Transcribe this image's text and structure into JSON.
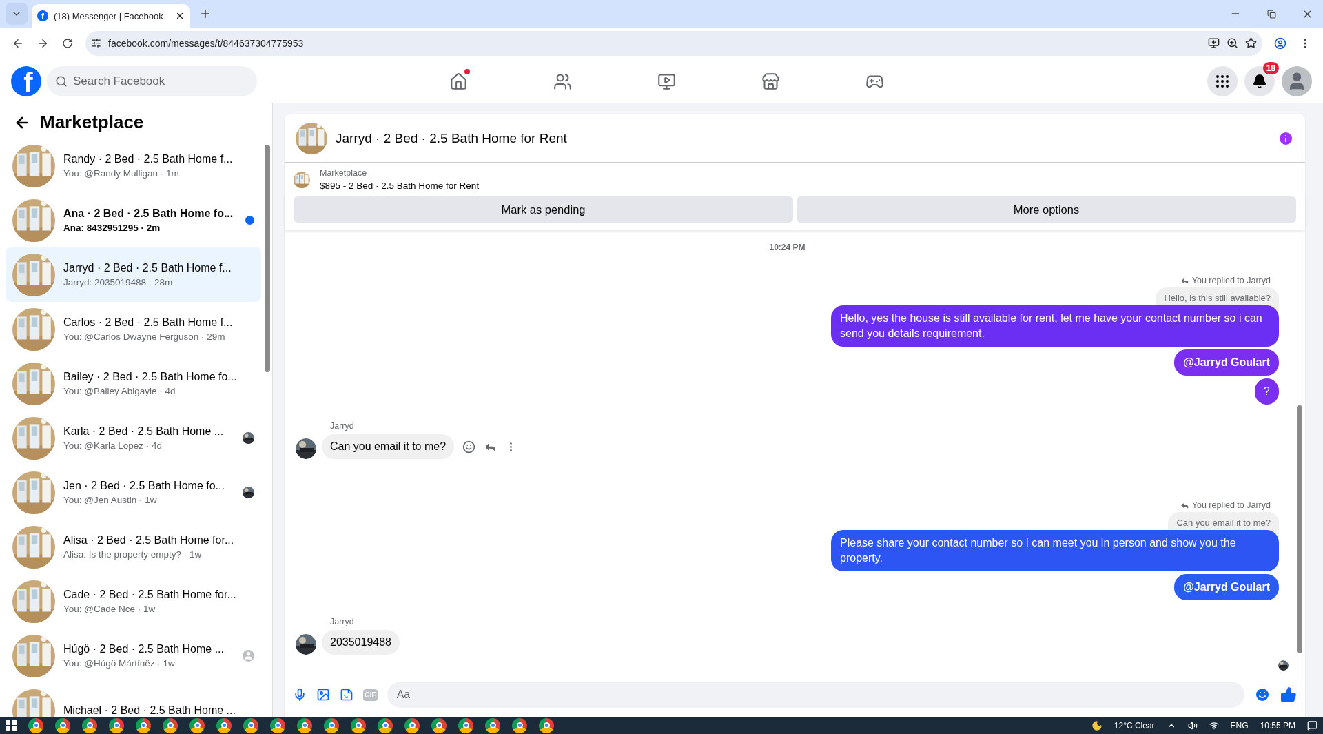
{
  "browser": {
    "favicon": "f",
    "tab_title": "(18) Messenger | Facebook",
    "url": "facebook.com/messages/t/844637304775953"
  },
  "header": {
    "logo": "f",
    "search_placeholder": "Search Facebook",
    "nav": [
      {
        "dot": true
      },
      {
        "dot": false
      },
      {
        "dot": false
      },
      {
        "dot": false
      },
      {
        "dot": false
      }
    ],
    "notification_count": "18"
  },
  "sidebar": {
    "title": "Marketplace",
    "conversations": [
      {
        "kind": "plain",
        "title": "Randy · 2 Bed · 2.5 Bath Home f...",
        "preview": "You: @Randy Mulligan · 1m",
        "unread": false,
        "selected": false
      },
      {
        "kind": "plain",
        "title": "Ana · 2 Bed · 2.5 Bath Home fo...",
        "preview": "Ana: 8432951295 · 2m",
        "unread": true,
        "selected": false
      },
      {
        "kind": "plain",
        "title": "Jarryd · 2 Bed · 2.5 Bath Home f...",
        "preview": "Jarryd: 2035019488 · 28m",
        "unread": false,
        "selected": true
      },
      {
        "kind": "plain",
        "title": "Carlos · 2 Bed · 2.5 Bath Home f...",
        "preview": "You: @Carlos Dwayne Ferguson · 29m",
        "unread": false,
        "selected": false
      },
      {
        "kind": "plain",
        "title": "Bailey · 2 Bed · 2.5 Bath Home fo...",
        "preview": "You: @Bailey Abigayle · 4d",
        "unread": false,
        "selected": false
      },
      {
        "title": "Karla · 2 Bed · 2.5 Bath Home ...",
        "preview": "You: @Karla Lopez · 4d",
        "unread": false,
        "selected": false
      },
      {
        "title": "Jen · 2 Bed · 2.5 Bath Home fo...",
        "preview": "You: @Jen Austin · 1w",
        "unread": false,
        "selected": false
      },
      {
        "kind": "plain",
        "title": "Alisa · 2 Bed · 2.5 Bath Home for...",
        "preview": "Alisa: Is the property empty? · 1w",
        "unread": false,
        "selected": false
      },
      {
        "kind": "plain",
        "title": "Cade · 2 Bed · 2.5 Bath Home for...",
        "preview": "You: @Cade Nce · 1w",
        "unread": false,
        "selected": false
      },
      {
        "kind": "avatar",
        "title": "Húgö · 2 Bed · 2.5 Bath Home ...",
        "preview": "You: @Húgö Mártínëz · 1w",
        "unread": false,
        "selected": false
      },
      {
        "kind": "plain",
        "title": "Michael · 2 Bed · 2.5 Bath Home ...",
        "unread": false,
        "selected": false
      }
    ]
  },
  "chat": {
    "title": "Jarryd · 2 Bed · 2.5 Bath Home for Rent",
    "listing": {
      "source": "Marketplace",
      "summary": "$895 - 2 Bed · 2.5 Bath Home for Rent"
    },
    "actions": [
      "Mark as pending",
      "More options"
    ],
    "messages": [
      {
        "kind": "time",
        "text": "10:24 PM"
      },
      {
        "kind": "outgoing",
        "reply_label": "You replied to Jarryd",
        "quote": "Hello, is this still available?",
        "text": "Hello, yes the house is still available for rent, let me have your contact number so i can send you details requirement.",
        "color": "#6b2ff3"
      },
      {
        "kind": "mention",
        "text": "@Jarryd Goulart",
        "color": "#7a2ff0"
      },
      {
        "kind": "outgoing",
        "text": "?",
        "color": "#7b2ff0"
      },
      {
        "kind": "incoming",
        "sender": "Jarryd",
        "text": "Can you email it to me?",
        "hovered": true
      },
      {
        "kind": "outgoing",
        "reply_label": "You replied to Jarryd",
        "quote": "Can you email it to me?",
        "text": "Please share your contact number so I can meet you in person and show you the property.",
        "color": "#2d55f4"
      },
      {
        "kind": "mention",
        "text": "@Jarryd Goulart",
        "color": "#2a5cf3"
      },
      {
        "kind": "incoming",
        "sender": "Jarryd",
        "text": "2035019488",
        "hovered": false
      },
      {
        "kind": "seen"
      }
    ],
    "composer": {
      "gif": "GIF",
      "placeholder": "Aa"
    }
  },
  "taskbar": {
    "weather": "12°C  Clear",
    "language": "ENG",
    "time": "10:55 PM"
  }
}
